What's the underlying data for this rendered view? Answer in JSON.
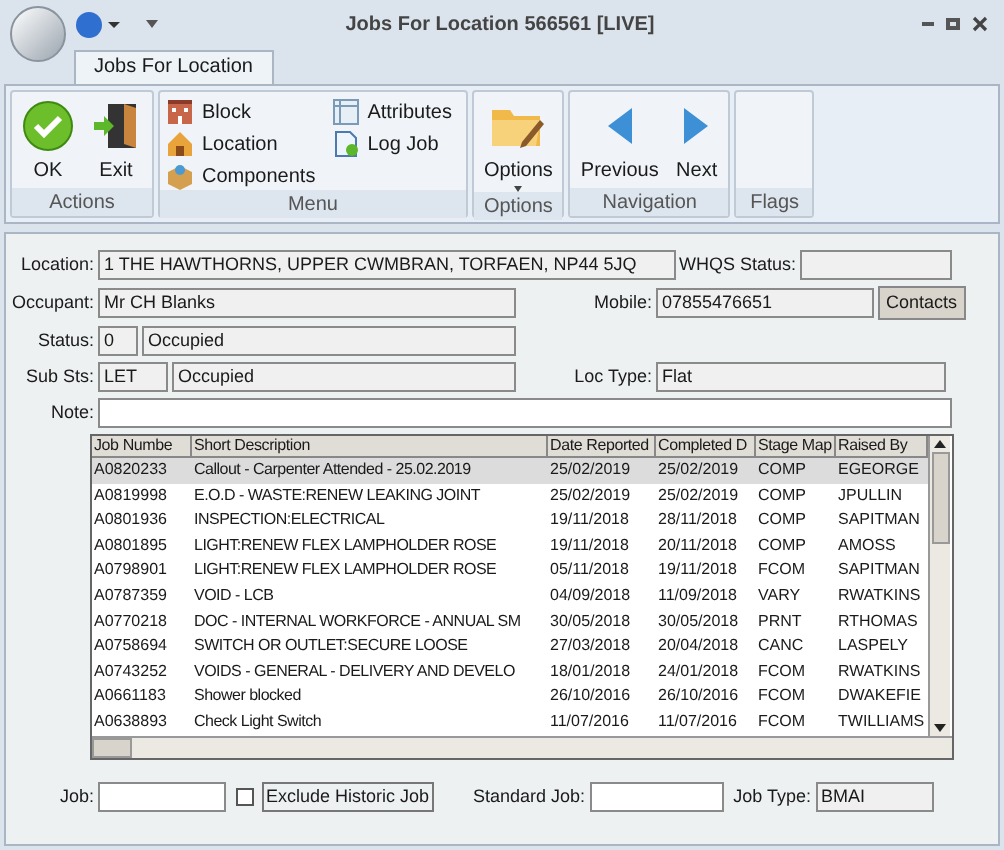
{
  "window": {
    "title": "Jobs For Location 566561 [LIVE]"
  },
  "tabs": [
    {
      "label": "Jobs For Location",
      "selected": true
    }
  ],
  "ribbon": {
    "groups": [
      {
        "label": "Actions",
        "items": [
          {
            "kind": "large",
            "label": "OK"
          },
          {
            "kind": "large",
            "label": "Exit"
          }
        ]
      },
      {
        "label": "Menu",
        "columns": [
          [
            {
              "label": "Block"
            },
            {
              "label": "Location"
            },
            {
              "label": "Components"
            }
          ],
          [
            {
              "label": "Attributes"
            },
            {
              "label": "Log Job"
            }
          ]
        ]
      },
      {
        "label": "Options",
        "items": [
          {
            "kind": "dropdown",
            "label": "Options"
          }
        ]
      },
      {
        "label": "Navigation",
        "items": [
          {
            "kind": "large",
            "label": "Previous"
          },
          {
            "kind": "large",
            "label": "Next"
          }
        ]
      },
      {
        "label": "Flags"
      }
    ]
  },
  "form": {
    "location": {
      "label": "Location:",
      "value": "1 THE HAWTHORNS, UPPER CWMBRAN, TORFAEN, NP44 5JQ"
    },
    "whqs_status": {
      "label": "WHQS Status:"
    },
    "occupant": {
      "label": "Occupant:",
      "value": "Mr CH Blanks"
    },
    "mobile": {
      "label": "Mobile:",
      "value": "07855476651"
    },
    "contacts_button": "Contacts",
    "status": {
      "label": "Status:",
      "code": "0",
      "value": "Occupied"
    },
    "sub_status": {
      "label": "Sub Sts:",
      "code": "LET",
      "value": "Occupied"
    },
    "loc_type": {
      "label": "Loc Type:",
      "value": "Flat"
    },
    "note": {
      "label": "Note:"
    }
  },
  "table": {
    "columns": [
      "Job Numbe",
      "Short Description",
      "Date Reported",
      "Completed D",
      "Stage Map",
      "Raised By"
    ],
    "rows": [
      {
        "selected": true,
        "cells": [
          "A0820233",
          "Callout - Carpenter Attended - 25.02.2019",
          "25/02/2019",
          "25/02/2019",
          "COMP",
          "EGEORGE"
        ]
      },
      {
        "selected": false,
        "cells": [
          "A0819998",
          "E.O.D - WASTE:RENEW LEAKING JOINT",
          "25/02/2019",
          "25/02/2019",
          "COMP",
          "JPULLIN"
        ]
      },
      {
        "selected": false,
        "cells": [
          "A0801936",
          "INSPECTION:ELECTRICAL",
          "19/11/2018",
          "28/11/2018",
          "COMP",
          "SAPITMAN"
        ]
      },
      {
        "selected": false,
        "cells": [
          "A0801895",
          "LIGHT:RENEW FLEX LAMPHOLDER ROSE",
          "19/11/2018",
          "20/11/2018",
          "COMP",
          "AMOSS"
        ]
      },
      {
        "selected": false,
        "cells": [
          "A0798901",
          "LIGHT:RENEW FLEX LAMPHOLDER ROSE",
          "05/11/2018",
          "19/11/2018",
          "FCOM",
          "SAPITMAN"
        ]
      },
      {
        "selected": false,
        "cells": [
          "A0787359",
          "VOID - LCB",
          "04/09/2018",
          "11/09/2018",
          "VARY",
          "RWATKINS"
        ]
      },
      {
        "selected": false,
        "cells": [
          "A0770218",
          "DOC - INTERNAL WORKFORCE - ANNUAL SM",
          "30/05/2018",
          "30/05/2018",
          "PRNT",
          "RTHOMAS"
        ]
      },
      {
        "selected": false,
        "cells": [
          "A0758694",
          "SWITCH OR OUTLET:SECURE LOOSE",
          "27/03/2018",
          "20/04/2018",
          "CANC",
          "LASPELY"
        ]
      },
      {
        "selected": false,
        "cells": [
          "A0743252",
          "VOIDS - GENERAL  - DELIVERY AND DEVELO",
          "18/01/2018",
          "24/01/2018",
          "FCOM",
          "RWATKINS"
        ]
      },
      {
        "selected": false,
        "cells": [
          "A0661183",
          "Shower blocked",
          "26/10/2016",
          "26/10/2016",
          "FCOM",
          "DWAKEFIE"
        ]
      },
      {
        "selected": false,
        "cells": [
          "A0638893",
          "Check Light Switch",
          "11/07/2016",
          "11/07/2016",
          "FCOM",
          "TWILLIAMS"
        ]
      }
    ]
  },
  "filters": {
    "job": {
      "label": "Job:"
    },
    "exclude_historic": {
      "label": "Exclude Historic Job",
      "checked": false
    },
    "standard_job": {
      "label": "Standard Job:"
    },
    "job_type": {
      "label": "Job Type:",
      "value": "BMAI"
    }
  }
}
